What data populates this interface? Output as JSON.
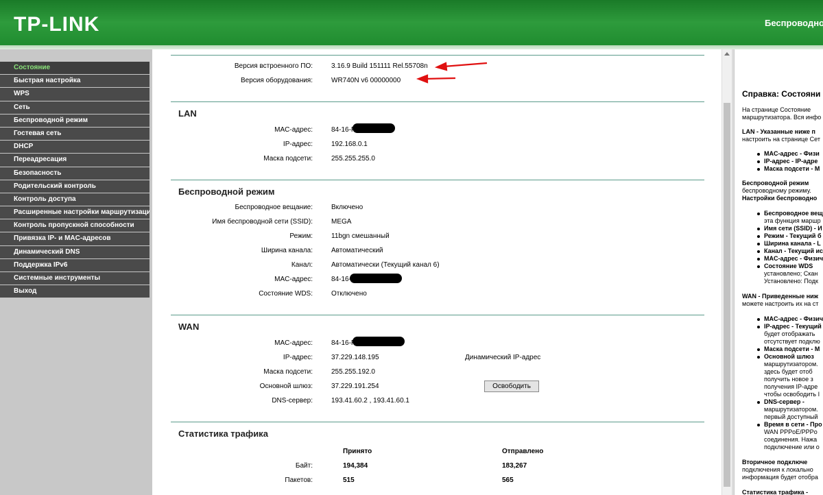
{
  "header": {
    "logo": "TP-LINK",
    "title": "Беспроводно"
  },
  "sidebar": {
    "items": [
      "Состояние",
      "Быстрая настройка",
      "WPS",
      "Сеть",
      "Беспроводной режим",
      "Гостевая сеть",
      "DHCP",
      "Переадресация",
      "Безопасность",
      "Родительский контроль",
      "Контроль доступа",
      "Расширенные настройки маршрутизации",
      "Контроль пропускной способности",
      "Привязка IP- и MAC-адресов",
      "Динамический DNS",
      "Поддержка IPv6",
      "Системные инструменты",
      "Выход"
    ]
  },
  "firmware": {
    "firmware_label": "Версия встроенного ПО:",
    "firmware_value": "3.16.9 Build 151111 Rel.55708n",
    "hardware_label": "Версия оборудования:",
    "hardware_value": "WR740N v6 00000000"
  },
  "lan": {
    "title": "LAN",
    "mac_label": "MAC-адрес:",
    "mac_value": "84-16-F",
    "ip_label": "IP-адрес:",
    "ip_value": "192.168.0.1",
    "mask_label": "Маска подсети:",
    "mask_value": "255.255.255.0"
  },
  "wireless": {
    "title": "Беспроводной режим",
    "broadcast_label": "Беспроводное вещание:",
    "broadcast_value": "Включено",
    "ssid_label": "Имя беспроводной сети (SSID):",
    "ssid_value": "MEGA",
    "mode_label": "Режим:",
    "mode_value": "11bgn смешанный",
    "width_label": "Ширина канала:",
    "width_value": "Автоматический",
    "channel_label": "Канал:",
    "channel_value": "Автоматически (Текущий канал 6)",
    "mac_label": "MAC-адрес:",
    "mac_value": "84-16-",
    "wds_label": "Состояние WDS:",
    "wds_value": "Отключено"
  },
  "wan": {
    "title": "WAN",
    "mac_label": "MAC-адрес:",
    "mac_value": "84-16-F",
    "ip_label": "IP-адрес:",
    "ip_value": "37.229.148.195",
    "ip_type": "Динамический IP-адрес",
    "mask_label": "Маска подсети:",
    "mask_value": "255.255.192.0",
    "gw_label": "Основной шлюз:",
    "gw_value": "37.229.191.254",
    "release_button": "Освободить",
    "dns_label": "DNS-сервер:",
    "dns_value": "193.41.60.2 , 193.41.60.1"
  },
  "traffic": {
    "title": "Статистика трафика",
    "received": "Принято",
    "sent": "Отправлено",
    "bytes_label": "Байт:",
    "bytes_received": "194,384",
    "bytes_sent": "183,267",
    "packets_label": "Пакетов:",
    "packets_received": "515",
    "packets_sent": "565"
  },
  "help": {
    "title": "Справка: Состояни",
    "lines": [
      "На  странице  Состояние",
      "маршрутизатора. Вся инфо",
      "LAN - Указанные  ниже  п",
      "настроить на странице Сет",
      "MAC-адрес - Физи",
      "IP-адрес - IP-адре",
      "Маска подсети - М",
      "Беспроводной    режим",
      "беспроводному   режиму.",
      "Настройки беспроводно",
      "Беспроводное вещ",
      "эта функция маршр",
      "Имя сети (SSID) - И",
      "Режим - Текущий б",
      "Ширина канала - L",
      "Канал - Текущий ис",
      "MAC-адрес - Физич",
      "Состояние   WDS",
      "установлено; Скан",
      "Установлено: Подк",
      "WAN  -  Приведенные  ниж",
      "можете настроить их на ст",
      "MAC-адрес - Физич",
      "IP-адрес - Текущий",
      "будет   отображать",
      "отсутствует подклю",
      "Маска подсети - М",
      "Основной   шлюз",
      "маршрутизатором.",
      "здесь   будет   отоб",
      "получить   новое   з",
      "получения   IP-адре",
      "чтобы освободить I",
      "DNS-сервер   -",
      "маршрутизатором.",
      "первый доступный",
      "Время в сети - Про",
      "WAN   PPPoE/PPPo",
      "соединения.   Нажа",
      "подключение или о",
      "Вторичное  подключе",
      "подключения  к  локально",
      "информация будет отобра",
      "Статистика трафика -"
    ]
  }
}
